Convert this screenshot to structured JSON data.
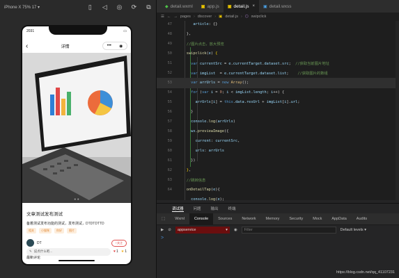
{
  "simulator": {
    "device_label": "iPhone X 75% 17 ▾",
    "status_time": "2031",
    "nav_title": "详情",
    "capsule_more": "•••",
    "capsule_close": "◉",
    "dots": "● ●",
    "post_title": "文章测试发布测试",
    "post_desc": "备着测试发布功能的测试，发布测试，DTDTDTTD",
    "tags": [
      "相关",
      "小猫咪",
      "你好",
      "图片"
    ],
    "author": "DT",
    "follow_label": "+关注",
    "latest_comments": "最新评论",
    "say_something": "说点什么吧...",
    "like_count": "1",
    "star_count": "1"
  },
  "editor": {
    "tabs": [
      {
        "label": "detail.wxml",
        "icon": "wxml-icon",
        "active": false
      },
      {
        "label": "app.js",
        "icon": "js-icon",
        "active": false
      },
      {
        "label": "detail.js",
        "icon": "js-icon",
        "active": true
      },
      {
        "label": "detail.wxss",
        "icon": "wxss-icon",
        "active": false
      }
    ],
    "breadcrumb": [
      "pages",
      "discover",
      "detail.js",
      "swipclick"
    ],
    "line_numbers": [
      "47",
      "48",
      "49",
      "50",
      "51",
      "52",
      "53",
      "54",
      "55",
      "56",
      "57",
      "58",
      "59",
      "60",
      "61",
      "62",
      "63",
      "64"
    ]
  },
  "panel": {
    "tabs": [
      "调试器",
      "问题",
      "输出",
      "终端"
    ],
    "devtools_tabs": [
      "Wxml",
      "Console",
      "Sources",
      "Network",
      "Memory",
      "Security",
      "Mock",
      "AppData",
      "Audits"
    ],
    "context": "appservice",
    "filter_placeholder": "Filter",
    "levels": "Default levels ▾",
    "prompt": ">"
  },
  "watermark": "https://blog.csdn.net/qq_41107231"
}
